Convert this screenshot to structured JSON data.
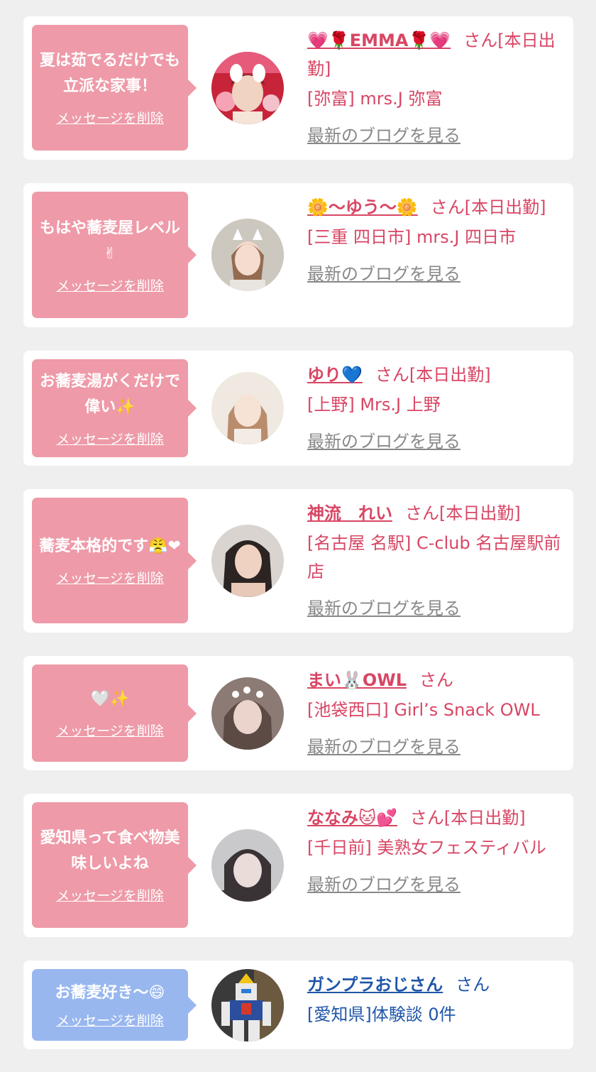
{
  "cards": [
    {
      "message": "夏は茹でるだけでも立派な家事！",
      "delete_label": "メッセージを削除",
      "name": "💗🌹EMMA🌹💗",
      "suffix": "さん[本日出勤]",
      "location": "[弥富] mrs.J 弥富",
      "blog": "最新のブログを見る",
      "avatar_icon": "woman-avatar-red",
      "theme": "pink"
    },
    {
      "message": "もはや蕎麦屋レベル✌",
      "delete_label": "メッセージを削除",
      "name": "🌼〜ゆう〜🌼",
      "suffix": "さん[本日出勤]",
      "location": "[三重 四日市] mrs.J 四日市",
      "blog": "最新のブログを見る",
      "avatar_icon": "woman-avatar-cat-ears",
      "theme": "pink"
    },
    {
      "message": "お蕎麦湯がくだけで偉い✨",
      "delete_label": "メッセージを削除",
      "name": "ゆり💙",
      "suffix": "さん[本日出勤]",
      "location": "[上野] Mrs.J 上野",
      "blog": "最新のブログを見る",
      "avatar_icon": "woman-avatar-light",
      "theme": "pink"
    },
    {
      "message": "蕎麦本格的です😤❤",
      "delete_label": "メッセージを削除",
      "name": "神流　れい",
      "suffix": "さん[本日出勤]",
      "location": "[名古屋 名駅] C-club 名古屋駅前店",
      "blog": "最新のブログを見る",
      "avatar_icon": "woman-avatar-dark-hair",
      "theme": "pink"
    },
    {
      "message": "🤍✨",
      "delete_label": "メッセージを削除",
      "name": "まい🐰OWL",
      "suffix": "さん",
      "location": "[池袋西口] Girl’s Snack OWL",
      "blog": "最新のブログを見る",
      "avatar_icon": "woman-avatar-blurred",
      "theme": "pink"
    },
    {
      "message": "愛知県って食べ物美味しいよね",
      "delete_label": "メッセージを削除",
      "name": "ななみ🐱💕",
      "suffix": "さん[本日出勤]",
      "location": "[千日前] 美熟女フェスティバル",
      "blog": "最新のブログを見る",
      "avatar_icon": "woman-avatar-gray",
      "theme": "pink"
    },
    {
      "message": "お蕎麦好き〜😄",
      "delete_label": "メッセージを削除",
      "name": "ガンプラおじさん",
      "suffix": "さん",
      "location": "[愛知県]体験談 0件",
      "blog": "",
      "avatar_icon": "gundam-robot-avatar",
      "theme": "blue"
    }
  ],
  "colors": {
    "background": "#efefef",
    "card": "#ffffff",
    "bubble_pink": "#ee9aa8",
    "bubble_blue": "#99b7ef",
    "text_pink": "#d84664",
    "text_blue": "#1f56a8",
    "link_gray": "#888888"
  }
}
